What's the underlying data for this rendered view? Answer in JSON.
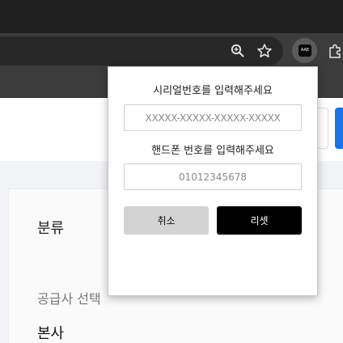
{
  "browser": {
    "zoom_icon": "zoom-magnifier-icon",
    "bookmark_icon": "star-icon",
    "extension_badge": "AAE",
    "extensions_icon": "puzzle-icon"
  },
  "page": {
    "category_label": "분류",
    "supplier_label": "공급사 선택",
    "supplier_value": "본사"
  },
  "popup": {
    "serial_label": "시리얼번호를 입력해주세요",
    "serial_placeholder": "XXXXX-XXXXX-XXXXX-XXXXX",
    "phone_label": "핸드폰 번호를 입력해주세요",
    "phone_placeholder": "01012345678",
    "cancel_label": "취소",
    "reset_label": "리셋"
  },
  "colors": {
    "accent_blue": "#1a73e8",
    "reset_button": "#000000",
    "cancel_button": "#d3d3d3"
  }
}
